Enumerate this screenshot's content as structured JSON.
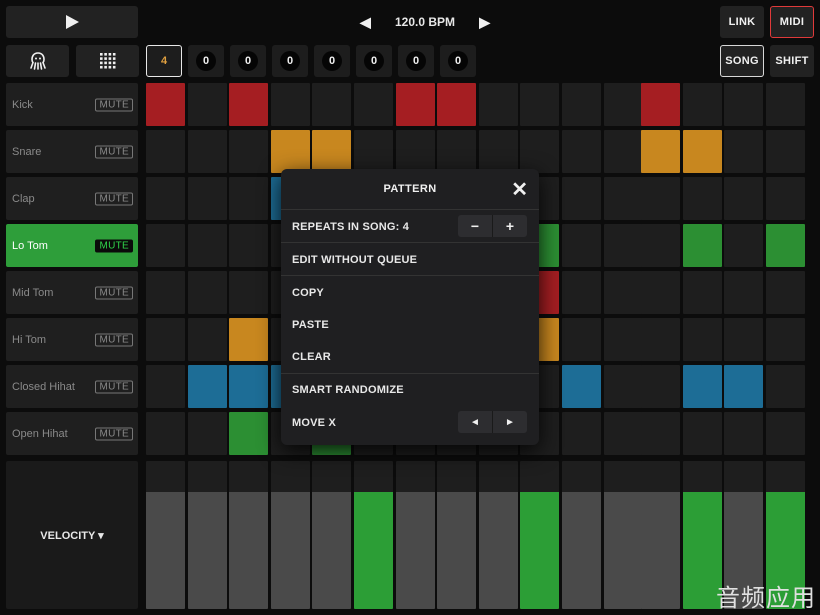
{
  "transport": {
    "play_icon": "play-icon"
  },
  "tempo": {
    "prev_icon": "triangle-left",
    "bpm_label": "120.0 BPM",
    "next_icon": "triangle-right"
  },
  "top_right": {
    "link_label": "LINK",
    "midi_label": "MIDI",
    "song_label": "SONG",
    "shift_label": "SHIFT"
  },
  "toolbar": {
    "octopus_icon": "octopus-icon",
    "grid_icon": "grid-icon"
  },
  "pattern_slots": [
    "4",
    "0",
    "0",
    "0",
    "0",
    "0",
    "0",
    "0"
  ],
  "tracks": [
    {
      "name": "Kick",
      "mute": "MUTE",
      "active": false
    },
    {
      "name": "Snare",
      "mute": "MUTE",
      "active": false
    },
    {
      "name": "Clap",
      "mute": "MUTE",
      "active": false
    },
    {
      "name": "Lo Tom",
      "mute": "MUTE",
      "active": true
    },
    {
      "name": "Mid Tom",
      "mute": "MUTE",
      "active": false
    },
    {
      "name": "Hi Tom",
      "mute": "MUTE",
      "active": false
    },
    {
      "name": "Closed Hihat",
      "mute": "MUTE",
      "active": false
    },
    {
      "name": "Open Hihat",
      "mute": "MUTE",
      "active": false
    }
  ],
  "colors": {
    "red": "#a51e22",
    "orange": "#c8871f",
    "blue": "#1d6d96",
    "green": "#2c8f33",
    "empty": "#1e1e1e",
    "accent_green": "#2e9e3a"
  },
  "grid": [
    [
      "red",
      "",
      "red",
      "",
      "",
      "",
      "red",
      "red",
      "",
      "",
      "",
      "",
      "red",
      "",
      "",
      ""
    ],
    [
      "",
      "",
      "",
      "orange",
      "orange",
      "",
      "",
      "",
      "",
      "",
      "",
      "",
      "orange",
      "orange",
      "",
      ""
    ],
    [
      "",
      "",
      "",
      "blue",
      "",
      "",
      "",
      "",
      "",
      "",
      "",
      "",
      "",
      "",
      "",
      ""
    ],
    [
      "",
      "",
      "",
      "",
      "",
      "",
      "",
      "",
      "",
      "green",
      "",
      "",
      "",
      "green",
      "",
      "green"
    ],
    [
      "",
      "",
      "",
      "",
      "",
      "",
      "",
      "",
      "",
      "red",
      "",
      "",
      "",
      "",
      "",
      ""
    ],
    [
      "",
      "",
      "orange",
      "",
      "",
      "",
      "",
      "",
      "",
      "orange",
      "",
      "",
      "",
      "",
      "",
      ""
    ],
    [
      "",
      "blue",
      "blue",
      "blue",
      "",
      "",
      "",
      "",
      "",
      "",
      "blue",
      "",
      "",
      "blue",
      "blue",
      ""
    ],
    [
      "",
      "",
      "green",
      "",
      "green",
      "",
      "",
      "",
      "",
      "",
      "",
      "",
      "",
      "",
      "",
      ""
    ]
  ],
  "velocity": {
    "label": "VELOCITY ▾",
    "levels": [
      0.79,
      0.79,
      0.79,
      0.79,
      0.79,
      0.79,
      0.79,
      0.79,
      0.79,
      0.79,
      0.79,
      0.79,
      0.79,
      0.79,
      0.79,
      0.79
    ],
    "colors": [
      "gray",
      "gray",
      "gray",
      "gray",
      "gray",
      "green",
      "gray",
      "gray",
      "gray",
      "green",
      "gray",
      "gray",
      "gray",
      "green",
      "gray",
      "green"
    ]
  },
  "modal": {
    "title": "PATTERN",
    "close_icon": "close-icon",
    "repeats_label": "REPEATS IN SONG: 4",
    "minus": "−",
    "plus": "+",
    "edit_without_queue": "EDIT WITHOUT QUEUE",
    "copy": "COPY",
    "paste": "PASTE",
    "clear": "CLEAR",
    "smart_randomize": "SMART RANDOMIZE",
    "move_x": "MOVE X",
    "move_left": "◄",
    "move_right": "►"
  },
  "watermark": "音频应用"
}
